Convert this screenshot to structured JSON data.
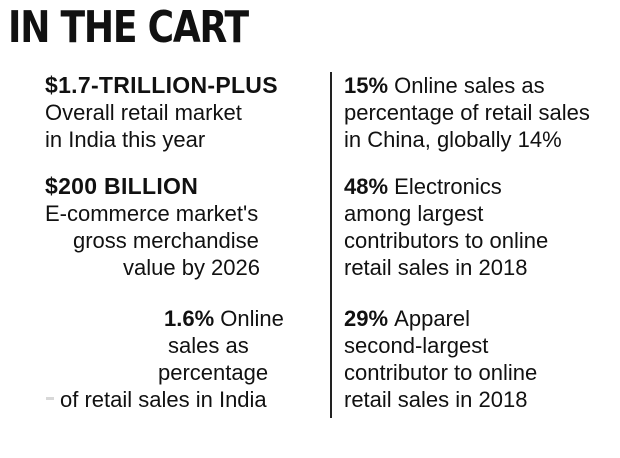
{
  "title": "IN THE CART",
  "left_stats": [
    {
      "headline": "$1.7-TRILLION-PLUS",
      "lines": [
        "Overall retail market",
        "in India this year"
      ]
    },
    {
      "headline": "$200 BILLION",
      "lines": [
        "E-commerce market's",
        "gross merchandise",
        "value by 2026"
      ]
    },
    {
      "figure": "1.6%",
      "first_line": "Online",
      "lines": [
        "sales as",
        "percentage",
        "of retail sales in India"
      ]
    }
  ],
  "right_stats": [
    {
      "figure": "15%",
      "first_line": "Online sales as",
      "lines": [
        "percentage of retail sales",
        "in China, globally 14%"
      ]
    },
    {
      "figure": "48%",
      "first_line": "Electronics",
      "lines": [
        "among largest",
        "contributors to online",
        "retail sales in 2018"
      ]
    },
    {
      "figure": "29%",
      "first_line": "Apparel",
      "lines": [
        "second-largest",
        "contributor to online",
        "retail sales in 2018"
      ]
    }
  ]
}
